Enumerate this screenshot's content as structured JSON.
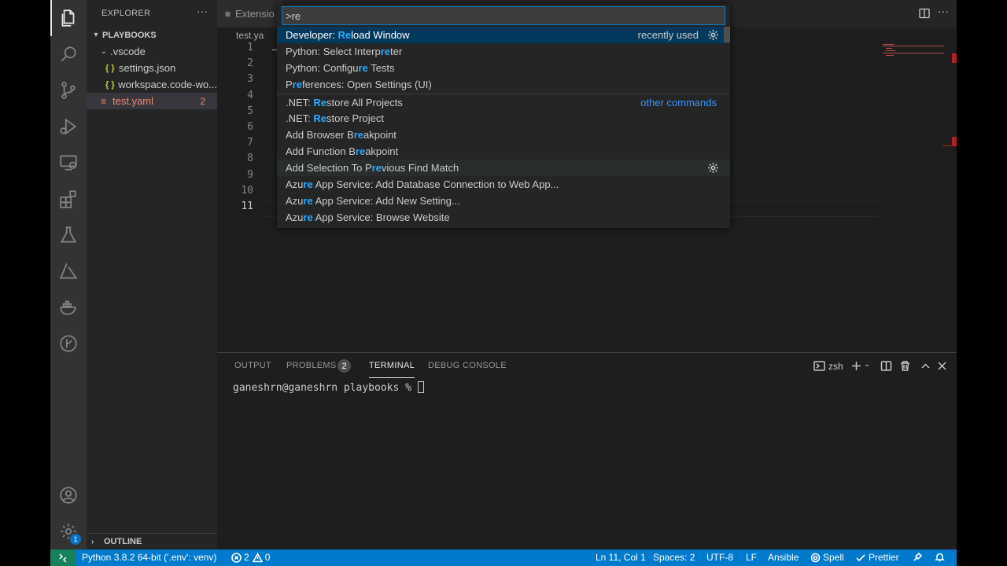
{
  "sidebar": {
    "title": "EXPLORER",
    "more": "···",
    "workspace": "PLAYBOOKS",
    "items": [
      {
        "label": ".vscode"
      },
      {
        "label": "settings.json",
        "icon": "{ }"
      },
      {
        "label": "workspace.code-wo...",
        "icon": "{ }"
      },
      {
        "label": "test.yaml",
        "icon": "≡",
        "problems": "2"
      }
    ],
    "outline": "OUTLINE"
  },
  "editor": {
    "tab_label": "Extensio",
    "breadcrumb": "test.ya",
    "line_numbers": [
      "1",
      "2",
      "3",
      "4",
      "5",
      "6",
      "7",
      "8",
      "9",
      "10",
      "11"
    ],
    "more": "···"
  },
  "palette": {
    "input_value": ">re",
    "items": [
      {
        "segments": [
          {
            "t": "Developer: "
          },
          {
            "t": "Re",
            "h": true
          },
          {
            "t": "load Window"
          }
        ],
        "meta": "recently used",
        "gear": true
      },
      {
        "segments": [
          {
            "t": "Python: Select Interp"
          },
          {
            "t": "re",
            "h": true
          },
          {
            "t": "ter"
          }
        ]
      },
      {
        "segments": [
          {
            "t": "Python: Configu"
          },
          {
            "t": "re",
            "h": true
          },
          {
            "t": " Tests"
          }
        ]
      },
      {
        "segments": [
          {
            "t": "P"
          },
          {
            "t": "re",
            "h": true
          },
          {
            "t": "ferences: Open Settings (UI)"
          }
        ]
      },
      {
        "segments": [
          {
            "t": ".NET: "
          },
          {
            "t": "Re",
            "h": true
          },
          {
            "t": "store All Projects"
          }
        ],
        "link": "other commands"
      },
      {
        "segments": [
          {
            "t": ".NET: "
          },
          {
            "t": "Re",
            "h": true
          },
          {
            "t": "store Project"
          }
        ]
      },
      {
        "segments": [
          {
            "t": "Add Browser B"
          },
          {
            "t": "re",
            "h": true
          },
          {
            "t": "akpoint"
          }
        ]
      },
      {
        "segments": [
          {
            "t": "Add Function B"
          },
          {
            "t": "re",
            "h": true
          },
          {
            "t": "akpoint"
          }
        ]
      },
      {
        "segments": [
          {
            "t": "Add Selection To P"
          },
          {
            "t": "re",
            "h": true
          },
          {
            "t": "vious Find Match"
          }
        ],
        "gear": true
      },
      {
        "segments": [
          {
            "t": "Azu"
          },
          {
            "t": "re",
            "h": true
          },
          {
            "t": " App Service: Add Database Connection to Web App..."
          }
        ]
      },
      {
        "segments": [
          {
            "t": "Azu"
          },
          {
            "t": "re",
            "h": true
          },
          {
            "t": " App Service: Add New Setting..."
          }
        ]
      },
      {
        "segments": [
          {
            "t": "Azu"
          },
          {
            "t": "re",
            "h": true
          },
          {
            "t": " App Service: Browse Website"
          }
        ]
      }
    ]
  },
  "panel": {
    "tabs": [
      "OUTPUT",
      "PROBLEMS",
      "TERMINAL",
      "DEBUG CONSOLE"
    ],
    "problems_count": "2",
    "shell": "zsh",
    "prompt": "ganeshrn@ganeshrn playbooks % "
  },
  "status": {
    "python": "Python 3.8.2 64-bit ('.env': venv)",
    "errors": "2",
    "warnings": "0",
    "position": "Ln 11, Col 1",
    "spaces": "Spaces: 2",
    "encoding": "UTF-8",
    "eol": "LF",
    "language": "Ansible",
    "spell": "Spell",
    "prettier": "Prettier"
  },
  "activity": {
    "accounts_badge": "1"
  },
  "colors": {
    "accent": "#007acc",
    "selection": "#04395e",
    "highlight": "#2aaaff",
    "error": "#f48771",
    "remote": "#16825d"
  },
  "icons": [
    "files-icon",
    "search-icon",
    "source-control-icon",
    "run-debug-icon",
    "remote-explorer-icon",
    "extensions-icon",
    "testing-icon",
    "azure-icon",
    "docker-icon",
    "gitlens-icon",
    "accounts-icon",
    "manage-gear-icon"
  ]
}
